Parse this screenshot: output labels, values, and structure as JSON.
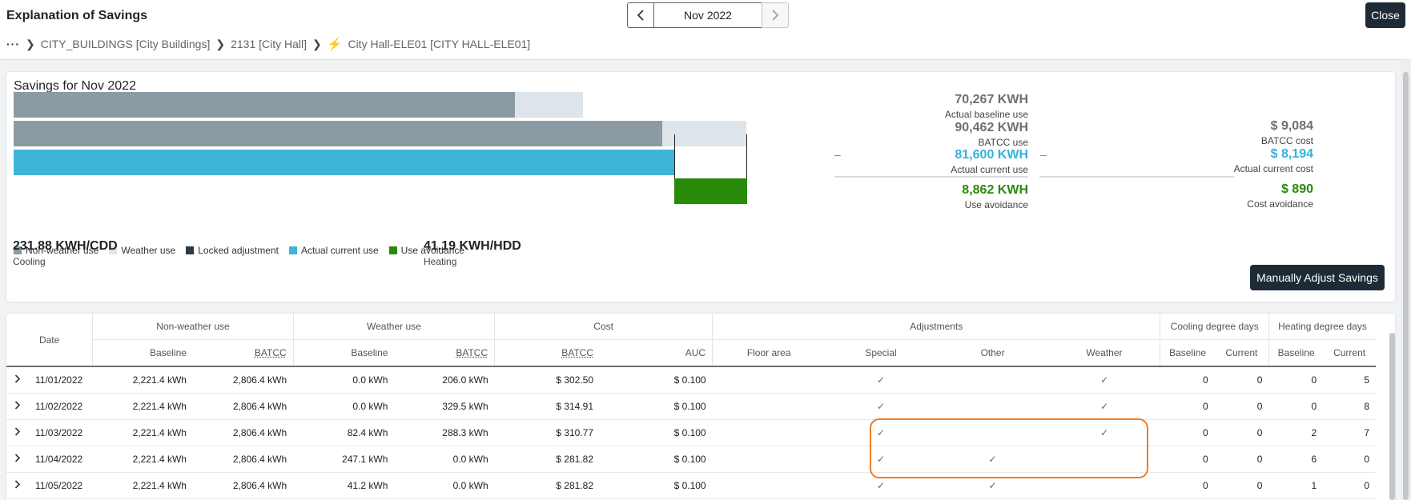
{
  "header": {
    "title": "Explanation of Savings",
    "month": "Nov 2022",
    "close_label": "Close",
    "breadcrumb": {
      "dots": "···",
      "items": [
        "CITY_BUILDINGS [City Buildings]",
        "2131 [City Hall]",
        "City Hall-ELE01 [CITY HALL-ELE01]"
      ]
    }
  },
  "savings": {
    "title": "Savings for Nov 2022",
    "stats": {
      "actual_baseline": {
        "value": "70,267 KWH",
        "label": "Actual baseline use"
      },
      "batcc_use": {
        "value": "90,462 KWH",
        "label": "BATCC use"
      },
      "batcc_cost": {
        "value": "$ 9,084",
        "label": "BATCC cost"
      },
      "actual_current_use": {
        "value": "81,600 KWH",
        "label": "Actual current use"
      },
      "actual_current_cost": {
        "value": "$ 8,194",
        "label": "Actual current cost"
      },
      "use_avoidance": {
        "value": "8,862 KWH",
        "label": "Use avoidance"
      },
      "cost_avoidance": {
        "value": "$ 890",
        "label": "Cost avoidance"
      },
      "minus": "–"
    },
    "legend": [
      {
        "label": "Non-weather use",
        "color": "#8c9ba3"
      },
      {
        "label": "Weather use",
        "color": "#dde4ea"
      },
      {
        "label": "Locked adjustment",
        "color": "#2c3a45"
      },
      {
        "label": "Actual current use",
        "color": "#3eb4d9"
      },
      {
        "label": "Use avoidance",
        "color": "#2a8a0a"
      }
    ],
    "cooling": {
      "value": "231.88 KWH/CDD",
      "label": "Cooling"
    },
    "heating": {
      "value": "41.19 KWH/HDD",
      "label": "Heating"
    },
    "adjust_label": "Manually Adjust Savings"
  },
  "table": {
    "groups": {
      "date": "Date",
      "nonweather": "Non-weather use",
      "weather": "Weather use",
      "cost": "Cost",
      "adjustments": "Adjustments",
      "cdd": "Cooling degree days",
      "hdd": "Heating degree days"
    },
    "subheaders": {
      "baseline": "Baseline",
      "batcc": "BATCC",
      "auc": "AUC",
      "floor_area": "Floor area",
      "special": "Special",
      "other": "Other",
      "weather": "Weather",
      "current": "Current"
    },
    "check": "✓",
    "rows": [
      {
        "date": "11/01/2022",
        "nw_baseline": "2,221.4 kWh",
        "nw_batcc": "2,806.4 kWh",
        "w_baseline": "0.0 kWh",
        "w_batcc": "206.0 kWh",
        "cost_batcc": "$ 302.50",
        "auc": "$ 0.100",
        "special": "✓",
        "other": "",
        "weather": "✓",
        "cdd_base": "0",
        "cdd_cur": "0",
        "hdd_base": "0",
        "hdd_cur": "5"
      },
      {
        "date": "11/02/2022",
        "nw_baseline": "2,221.4 kWh",
        "nw_batcc": "2,806.4 kWh",
        "w_baseline": "0.0 kWh",
        "w_batcc": "329.5 kWh",
        "cost_batcc": "$ 314.91",
        "auc": "$ 0.100",
        "special": "✓",
        "other": "",
        "weather": "✓",
        "cdd_base": "0",
        "cdd_cur": "0",
        "hdd_base": "0",
        "hdd_cur": "8"
      },
      {
        "date": "11/03/2022",
        "nw_baseline": "2,221.4 kWh",
        "nw_batcc": "2,806.4 kWh",
        "w_baseline": "82.4 kWh",
        "w_batcc": "288.3 kWh",
        "cost_batcc": "$ 310.77",
        "auc": "$ 0.100",
        "special": "✓",
        "other": "",
        "weather": "✓",
        "cdd_base": "0",
        "cdd_cur": "0",
        "hdd_base": "2",
        "hdd_cur": "7"
      },
      {
        "date": "11/04/2022",
        "nw_baseline": "2,221.4 kWh",
        "nw_batcc": "2,806.4 kWh",
        "w_baseline": "247.1 kWh",
        "w_batcc": "0.0 kWh",
        "cost_batcc": "$ 281.82",
        "auc": "$ 0.100",
        "special": "✓",
        "other": "✓",
        "weather": "",
        "cdd_base": "0",
        "cdd_cur": "0",
        "hdd_base": "6",
        "hdd_cur": "0"
      },
      {
        "date": "11/05/2022",
        "nw_baseline": "2,221.4 kWh",
        "nw_batcc": "2,806.4 kWh",
        "w_baseline": "41.2 kWh",
        "w_batcc": "0.0 kWh",
        "cost_batcc": "$ 281.82",
        "auc": "$ 0.100",
        "special": "✓",
        "other": "✓",
        "weather": "",
        "cdd_base": "0",
        "cdd_cur": "0",
        "hdd_base": "1",
        "hdd_cur": "0"
      }
    ]
  }
}
